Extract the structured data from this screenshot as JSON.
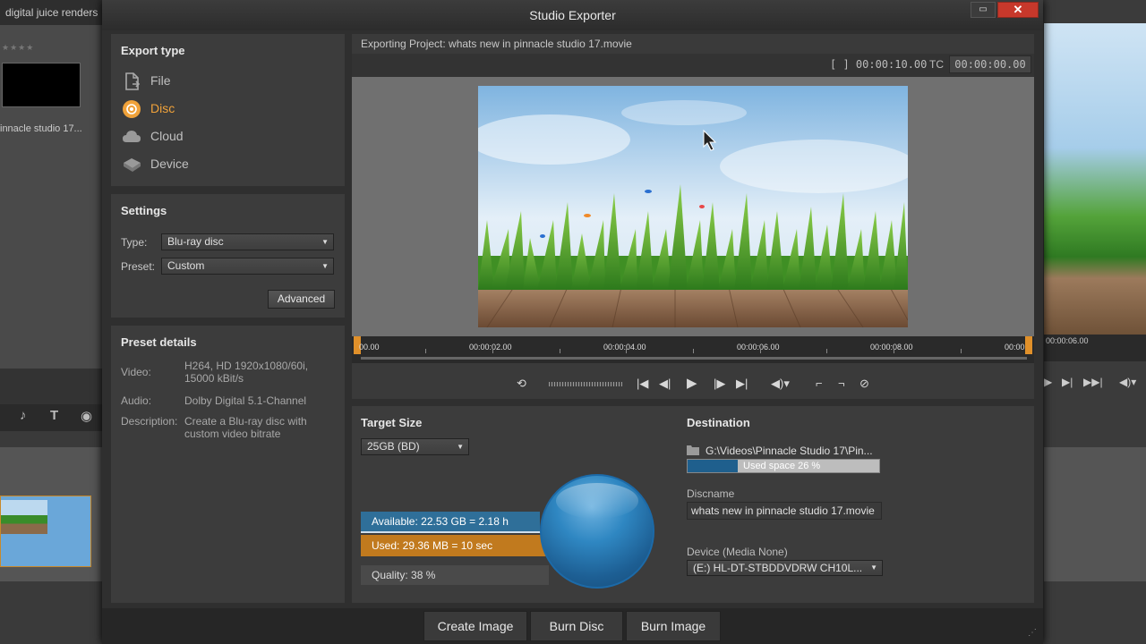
{
  "background_app": {
    "left_title": "digital juice renders",
    "stars": "★★★★",
    "clip_label": "innacle studio 17...",
    "right_timecode": "00:00:06.00"
  },
  "dialog": {
    "title": "Studio Exporter",
    "restore_glyph": "▭",
    "close_glyph": "✕"
  },
  "export_type": {
    "title": "Export type",
    "items": [
      {
        "label": "File",
        "icon": "file-icon"
      },
      {
        "label": "Disc",
        "icon": "disc-icon",
        "active": true
      },
      {
        "label": "Cloud",
        "icon": "cloud-icon"
      },
      {
        "label": "Device",
        "icon": "device-icon"
      }
    ]
  },
  "settings": {
    "title": "Settings",
    "type_label": "Type:",
    "type_value": "Blu-ray disc",
    "preset_label": "Preset:",
    "preset_value": "Custom",
    "advanced_label": "Advanced"
  },
  "preset_details": {
    "title": "Preset details",
    "video_label": "Video:",
    "video_value": "H264, HD 1920x1080/60i, 15000 kBit/s",
    "audio_label": "Audio:",
    "audio_value": "Dolby Digital 5.1-Channel",
    "description_label": "Description:",
    "description_value": "Create a Blu-ray disc with custom video bitrate"
  },
  "player": {
    "exporting_label": "Exporting Project: whats new in pinnacle studio 17.movie",
    "duration": "[ ] 00:00:10.00",
    "tc_label": "TC",
    "tc_value": "00:00:00.00",
    "ruler_ticks": [
      "00.00",
      "00:00:02.00",
      "00:00:04.00",
      "00:00:06.00",
      "00:00:08.00",
      "00:00"
    ]
  },
  "target": {
    "title": "Target Size",
    "size_value": "25GB (BD)",
    "available": "Available: 22.53 GB = 2.18 h",
    "used": "Used: 29.36 MB = 10 sec",
    "quality": "Quality:   38 %"
  },
  "destination": {
    "title": "Destination",
    "path": "G:\\Videos\\Pinnacle Studio 17\\Pin...",
    "used_space": "Used space 26 %",
    "used_space_fraction": 0.26,
    "discname_label": "Discname",
    "discname_value": "whats new in pinnacle studio 17.movie",
    "device_label": "Device  (Media None)",
    "device_value": "(E:) HL-DT-STBDDVDRW CH10L..."
  },
  "bottom": {
    "create_image": "Create Image",
    "burn_disc": "Burn Disc",
    "burn_image": "Burn Image"
  },
  "colors": {
    "accent_orange": "#f0a23a",
    "available_blue": "#2f6f99",
    "used_orange": "#c17a1e"
  }
}
